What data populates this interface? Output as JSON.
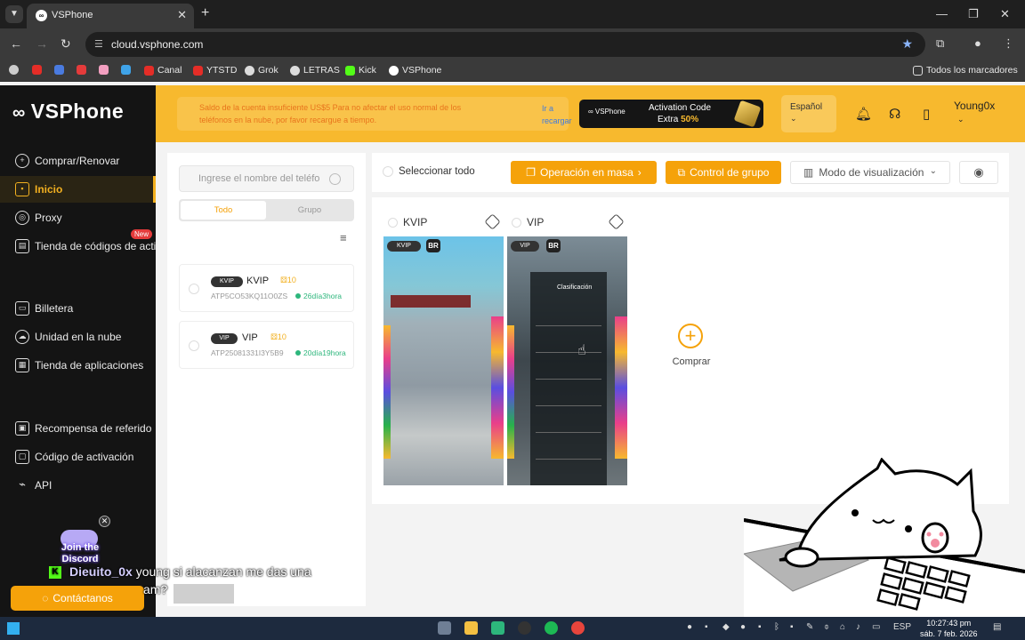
{
  "browser": {
    "tab_title": "VSPhone",
    "url": "cloud.vsphone.com",
    "bookmarks": [
      "Canal",
      "YTSTD",
      "Grok",
      "LETRAS",
      "Kick",
      "VSPhone"
    ],
    "all_bookmarks": "Todos los marcadores"
  },
  "sidebar": {
    "logo": "VSPhone",
    "items": [
      {
        "label": "Comprar/Renovar"
      },
      {
        "label": "Inicio"
      },
      {
        "label": "Proxy"
      },
      {
        "label": "Tienda de códigos de activa",
        "badge": "New"
      },
      {
        "label": "Billetera"
      },
      {
        "label": "Unidad en la nube"
      },
      {
        "label": "Tienda de aplicaciones"
      },
      {
        "label": "Recompensa de referido"
      },
      {
        "label": "Código de activación"
      },
      {
        "label": "API"
      }
    ],
    "discord": "Join the Discord",
    "contact": "Contáctanos"
  },
  "banner": {
    "notice": "Saldo de la cuenta insuficiente US$5 Para no afectar el uso normal de los teléfonos en la nube, por favor recargue a tiempo.",
    "recharge": "Ir a recargar",
    "promo_line1": "Activation Code",
    "promo_line2_prefix": "Extra ",
    "promo_line2_value": "50%",
    "language": "Español",
    "username": "Young0x"
  },
  "list": {
    "search_placeholder": "Ingrese el nombre del teléfo",
    "tab_all": "Todo",
    "tab_group": "Grupo",
    "devices": [
      {
        "tag": "KVIP",
        "name": "KVIP",
        "level": "10",
        "id": "ATP5CO53KQ11O0ZS",
        "time": "26día3hora"
      },
      {
        "tag": "VIP",
        "name": "VIP",
        "level": "10",
        "id": "ATP25081331I3Y5B9",
        "time": "20día19hora"
      }
    ]
  },
  "toolbar": {
    "select_all": "Seleccionar todo",
    "bulk_op": "Operación en masa",
    "group_control": "Control de grupo",
    "view_mode": "Modo de visualización"
  },
  "cards": [
    {
      "name": "KVIP",
      "badge": "KVIP",
      "region": "BR"
    },
    {
      "name": "VIP",
      "badge": "VIP",
      "region": "BR",
      "overlay_title": "Clasificación"
    }
  ],
  "buy_label": "Comprar",
  "chat": {
    "user": "Dieuito_0x",
    "line1": "young si alacanzan me das una",
    "line2": "am?"
  },
  "taskbar": {
    "lang": "ESP",
    "time": "10:27:43 pm",
    "date": "sáb. 7 feb. 2026"
  }
}
